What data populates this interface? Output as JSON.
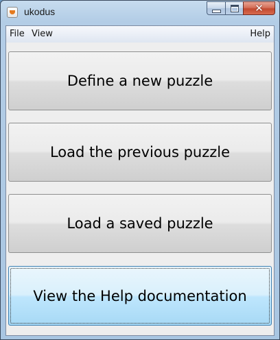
{
  "window": {
    "title": "ukodus"
  },
  "menu": {
    "file": "File",
    "view": "View",
    "help": "Help"
  },
  "buttons": {
    "define_new": "Define a new puzzle",
    "load_previous": "Load the previous puzzle",
    "load_saved": "Load a saved puzzle",
    "view_help": "View the Help documentation"
  }
}
